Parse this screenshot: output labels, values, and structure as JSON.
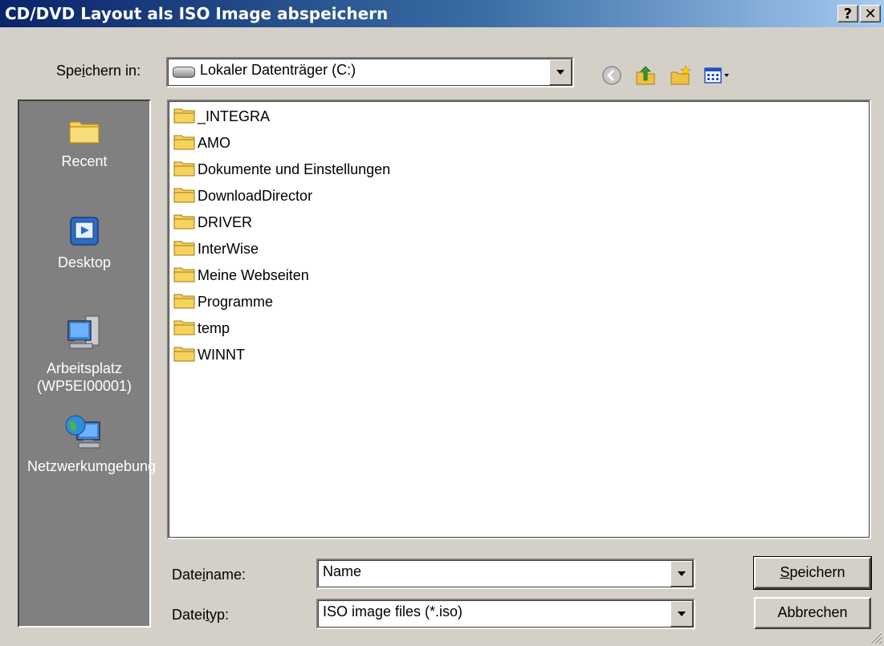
{
  "window": {
    "title": "CD/DVD Layout als ISO Image abspeichern",
    "help_button": "?",
    "close_button": "✕"
  },
  "savein": {
    "label_pre": "Spe",
    "label_u": "i",
    "label_post": "chern in:",
    "value": "Lokaler Datenträger (C:)",
    "value_icon": "hard-drive-icon"
  },
  "toolbar": {
    "icons": [
      "back-icon",
      "up-folder-icon",
      "new-folder-icon",
      "view-menu-icon"
    ]
  },
  "places": [
    {
      "label": "Recent",
      "icon": "recent-folder-icon"
    },
    {
      "label": "Desktop",
      "icon": "desktop-icon"
    },
    {
      "label": "Arbeitsplatz (WP5EI00001)",
      "icon": "my-computer-icon"
    },
    {
      "label": "Netzwerkumgebung",
      "icon": "network-icon"
    }
  ],
  "files": [
    "_INTEGRA",
    "AMO",
    "Dokumente und Einstellungen",
    "DownloadDirector",
    "DRIVER",
    "InterWise",
    "Meine Webseiten",
    "Programme",
    "temp",
    "WINNT"
  ],
  "filename": {
    "label_pre": "Date",
    "label_u": "i",
    "label_post": "name:",
    "value": "Name"
  },
  "filetype": {
    "label_pre": "Datei",
    "label_u": "t",
    "label_post": "yp:",
    "value": "ISO image files (*.iso)"
  },
  "buttons": {
    "save_u": "S",
    "save_rest": "peichern",
    "cancel": "Abbrechen"
  },
  "colors": {
    "titlebar_start": "#0a246a",
    "titlebar_end": "#a6caf0",
    "dialog_bg": "#d4d0c8",
    "places_bg": "#808080"
  }
}
